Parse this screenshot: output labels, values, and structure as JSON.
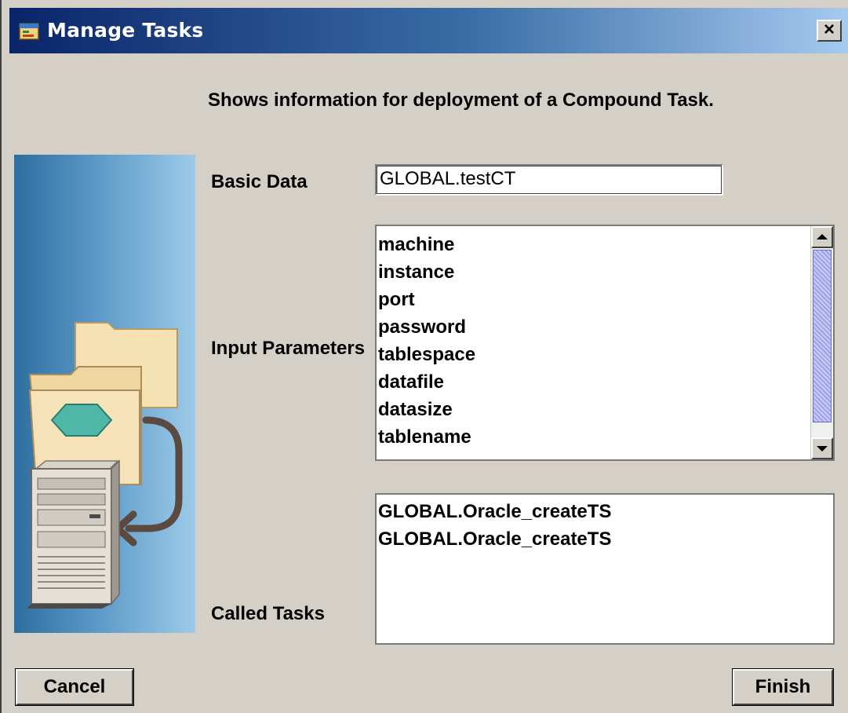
{
  "window": {
    "title": "Manage Tasks",
    "close_glyph": "×"
  },
  "heading": "Shows information for deployment of a Compound Task.",
  "basic_data": {
    "label": "Basic Data",
    "value": "GLOBAL.testCT"
  },
  "input_parameters": {
    "label": "Input Parameters",
    "items": [
      "machine",
      "instance",
      "port",
      "password",
      "tablespace",
      "datafile",
      "datasize",
      "tablename"
    ],
    "scroll_up_icon": "arrow-up-icon",
    "scroll_down_icon": "arrow-down-icon"
  },
  "called_tasks": {
    "label": "Called Tasks",
    "items": [
      "GLOBAL.Oracle_createTS",
      "GLOBAL.Oracle_createTS"
    ]
  },
  "buttons": {
    "cancel": "Cancel",
    "finish": "Finish"
  },
  "icons": {
    "title": "window-app-icon",
    "illustration": "folders-to-server-illustration"
  },
  "colors": {
    "title_bar_start": "#0a246a",
    "title_bar_end": "#a6caf0",
    "dialog_bg": "#d4d0c8",
    "scroll_thumb": "#9fa3e6"
  }
}
